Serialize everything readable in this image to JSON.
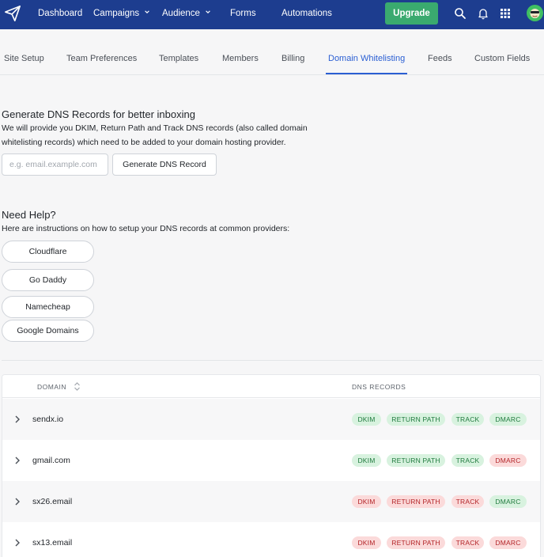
{
  "nav": {
    "items": [
      {
        "label": "Dashboard",
        "dropdown": false
      },
      {
        "label": "Campaigns",
        "dropdown": true
      },
      {
        "label": "Audience",
        "dropdown": true
      },
      {
        "label": "Forms",
        "dropdown": false
      },
      {
        "label": "Automations",
        "dropdown": false
      }
    ],
    "upgrade_label": "Upgrade",
    "icons": [
      "search-icon",
      "bell-icon",
      "apps-grid-icon"
    ],
    "colors": {
      "bar": "#1d3d8f",
      "upgrade": "#3aaa6f"
    }
  },
  "tabs": [
    {
      "label": "Site Setup",
      "active": false
    },
    {
      "label": "Team Preferences",
      "active": false
    },
    {
      "label": "Templates",
      "active": false
    },
    {
      "label": "Members",
      "active": false
    },
    {
      "label": "Billing",
      "active": false
    },
    {
      "label": "Domain Whitelisting",
      "active": true
    },
    {
      "label": "Feeds",
      "active": false
    },
    {
      "label": "Custom Fields",
      "active": false
    }
  ],
  "dns": {
    "title": "Generate DNS Records for better inboxing",
    "description_line1": "We will provide you DKIM, Return Path and Track DNS records (also called domain",
    "description_line2": "whitelisting records) which need to be added to your domain hosting provider.",
    "input_placeholder": "e.g. email.example.com",
    "input_value": "",
    "button_label": "Generate DNS Record"
  },
  "help": {
    "title": "Need Help?",
    "description": "Here are instructions on how to setup your DNS records at common providers:",
    "providers": [
      "Cloudflare",
      "Go Daddy",
      "Namecheap",
      "Google Domains"
    ]
  },
  "table": {
    "col_domain": "DOMAIN",
    "col_records": "DNS RECORDS",
    "record_labels": {
      "dkim": "DKIM",
      "return_path": "RETURN PATH",
      "track": "TRACK",
      "dmarc": "DMARC"
    },
    "rows": [
      {
        "domain": "sendx.io",
        "dkim": "ok",
        "return_path": "ok",
        "track": "ok",
        "dmarc": "ok"
      },
      {
        "domain": "gmail.com",
        "dkim": "ok",
        "return_path": "ok",
        "track": "ok",
        "dmarc": "bad"
      },
      {
        "domain": "sx26.email",
        "dkim": "bad",
        "return_path": "bad",
        "track": "bad",
        "dmarc": "ok"
      },
      {
        "domain": "sx13.email",
        "dkim": "bad",
        "return_path": "bad",
        "track": "bad",
        "dmarc": "bad"
      }
    ],
    "status_colors": {
      "ok_bg": "#d8f2df",
      "ok_text": "#1f7a3d",
      "bad_bg": "#fbdada",
      "bad_text": "#b32428"
    }
  }
}
